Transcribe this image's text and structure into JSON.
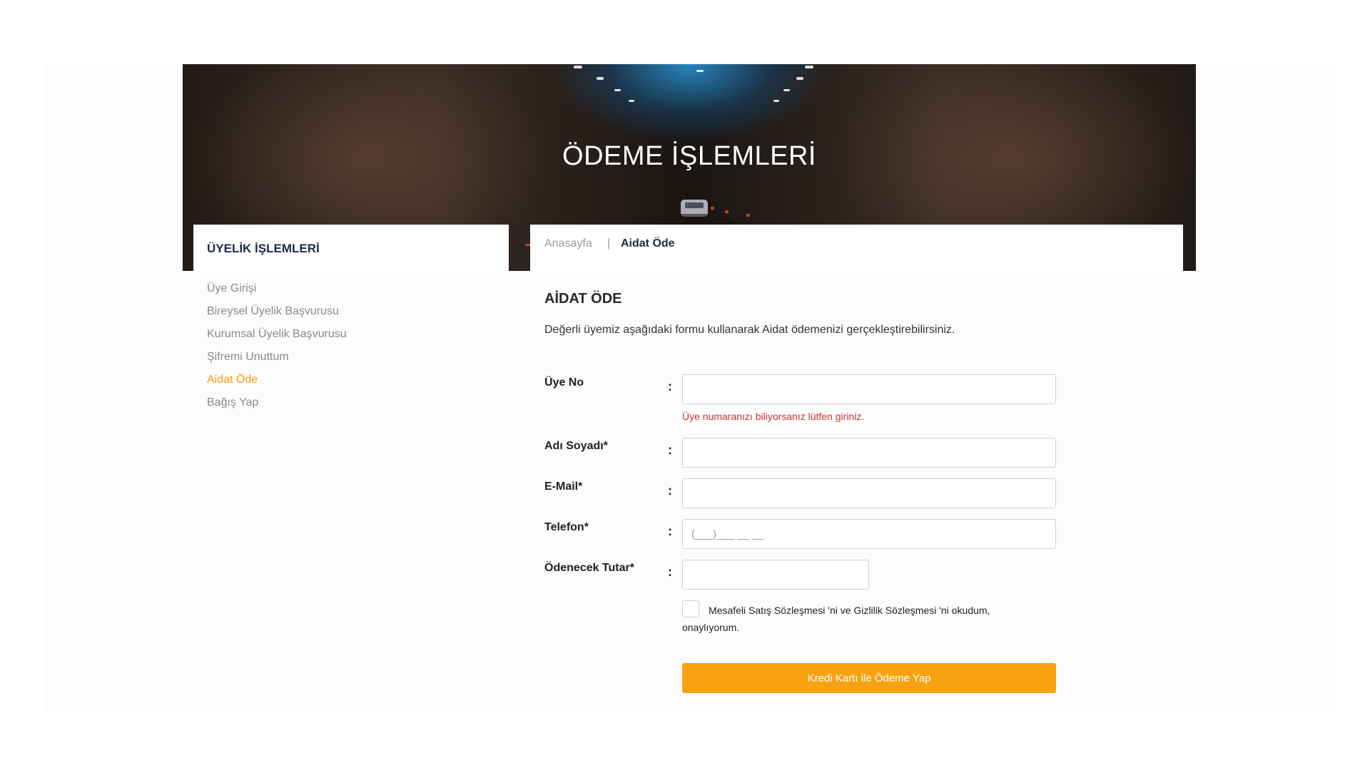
{
  "hero": {
    "title": "ÖDEME İŞLEMLERİ"
  },
  "sidebar": {
    "title": "ÜYELİK İŞLEMLERİ",
    "items": [
      {
        "label": "Üye Girişi"
      },
      {
        "label": "Bireysel Üyelik Başvurusu"
      },
      {
        "label": "Kurumsal Üyelik Başvurusu"
      },
      {
        "label": "Şifremi Unuttum"
      },
      {
        "label": "Aidat Öde"
      },
      {
        "label": "Bağış Yap"
      }
    ],
    "active_item": "Aidat Öde"
  },
  "breadcrumb": {
    "home": "Anasayfa",
    "separator": "|",
    "current": "Aidat Öde"
  },
  "form": {
    "title": "AİDAT ÖDE",
    "description": "Değerli üyemiz aşağıdaki formu kullanarak Aidat ödemenizi gerçekleştirebilirsiniz.",
    "colon": ":",
    "fields": {
      "member_no": {
        "label": "Üye No",
        "value": "",
        "hint": "Üye numaranızı biliyorsanız lütfen giriniz."
      },
      "name": {
        "label": "Adı Soyadı*",
        "value": ""
      },
      "email": {
        "label": "E-Mail*",
        "value": ""
      },
      "phone": {
        "label": "Telefon*",
        "value": "",
        "placeholder": "(___)___ __ __"
      },
      "amount": {
        "label": "Ödenecek Tutar*",
        "value": ""
      }
    },
    "agreement": {
      "checked": false,
      "text": "Mesafeli Satış Sözleşmesi 'ni ve Gizlilik Sözleşmesi 'ni okudum, onaylıyorum."
    },
    "submit_label": "Kredi Kartı ile Ödeme Yap"
  },
  "colors": {
    "accent": "#f7a211",
    "active_link": "#f39c12",
    "heading": "#1d2a44",
    "error": "#d0312d"
  }
}
